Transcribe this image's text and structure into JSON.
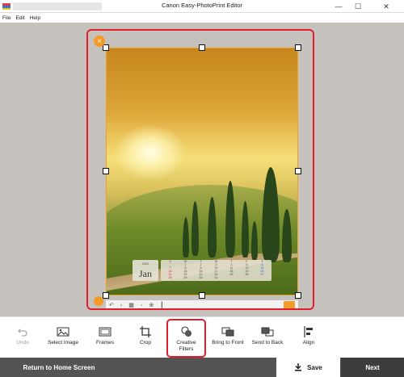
{
  "window": {
    "title": "Canon Easy-PhotoPrint Editor",
    "minimize_glyph": "—",
    "maximize_glyph": "☐",
    "close_glyph": "✕"
  },
  "menu": {
    "items": [
      "File",
      "Edit",
      "Help"
    ]
  },
  "calendar": {
    "year": "2024",
    "month": "Jan",
    "weekdays": [
      "S",
      "M",
      "T",
      "W",
      "T",
      "F",
      "S"
    ],
    "days": [
      "",
      "1",
      "2",
      "3",
      "4",
      "5",
      "6",
      "7",
      "8",
      "9",
      "10",
      "11",
      "12",
      "13",
      "14",
      "15",
      "16",
      "17",
      "18",
      "19",
      "20",
      "21",
      "22",
      "23",
      "24",
      "25",
      "26",
      "27",
      "28",
      "29",
      "30",
      "31",
      "",
      "",
      ""
    ]
  },
  "toolbar": {
    "tools": [
      {
        "label": "Undo",
        "icon": "undo-icon",
        "enabled": false
      },
      {
        "label": "Select Image",
        "icon": "select-image-icon",
        "enabled": true
      },
      {
        "label": "Frames",
        "icon": "frames-icon",
        "enabled": true
      },
      {
        "label": "Crop",
        "icon": "crop-icon",
        "enabled": true
      },
      {
        "label": "Creative Filters",
        "icon": "creative-filters-icon",
        "enabled": true,
        "highlighted": true
      },
      {
        "label": "Bring to Front",
        "icon": "bring-to-front-icon",
        "enabled": true
      },
      {
        "label": "Send to Back",
        "icon": "send-to-back-icon",
        "enabled": true
      },
      {
        "label": "Align",
        "icon": "align-icon",
        "enabled": true
      }
    ]
  },
  "bottom": {
    "home_label": "Return to Home Screen",
    "save_label": "Save",
    "next_label": "Next"
  },
  "colors": {
    "highlight": "#e41c2c",
    "accent": "#f39a28",
    "canvas_bg": "#c5c1bc",
    "bottom_bar": "#535353"
  }
}
